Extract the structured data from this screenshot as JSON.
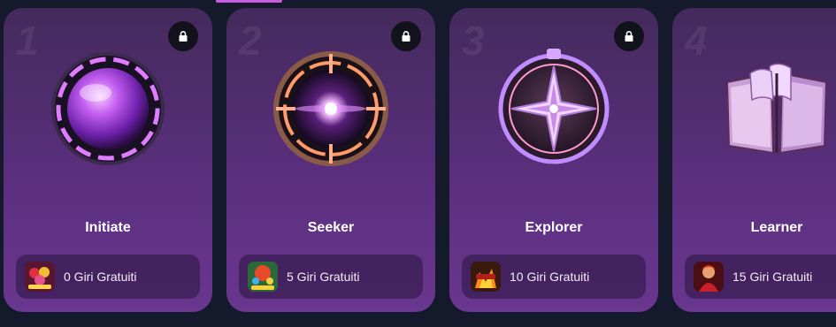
{
  "cards": [
    {
      "number": "1",
      "title": "Initiate",
      "reward": "0 Giri Gratuiti",
      "badge_icon": "orb-badge-icon",
      "locked": true
    },
    {
      "number": "2",
      "title": "Seeker",
      "reward": "5 Giri Gratuiti",
      "badge_icon": "compass-ring-badge-icon",
      "locked": true
    },
    {
      "number": "3",
      "title": "Explorer",
      "reward": "10 Giri Gratuiti",
      "badge_icon": "compass-star-badge-icon",
      "locked": true
    },
    {
      "number": "4",
      "title": "Learner",
      "reward": "15 Giri Gratuiti",
      "badge_icon": "open-book-badge-icon",
      "locked": false
    }
  ],
  "colors": {
    "background": "#141a2c",
    "card_top": "#442a5c",
    "card_bottom": "#6a3690",
    "accent": "#c65ce0"
  }
}
